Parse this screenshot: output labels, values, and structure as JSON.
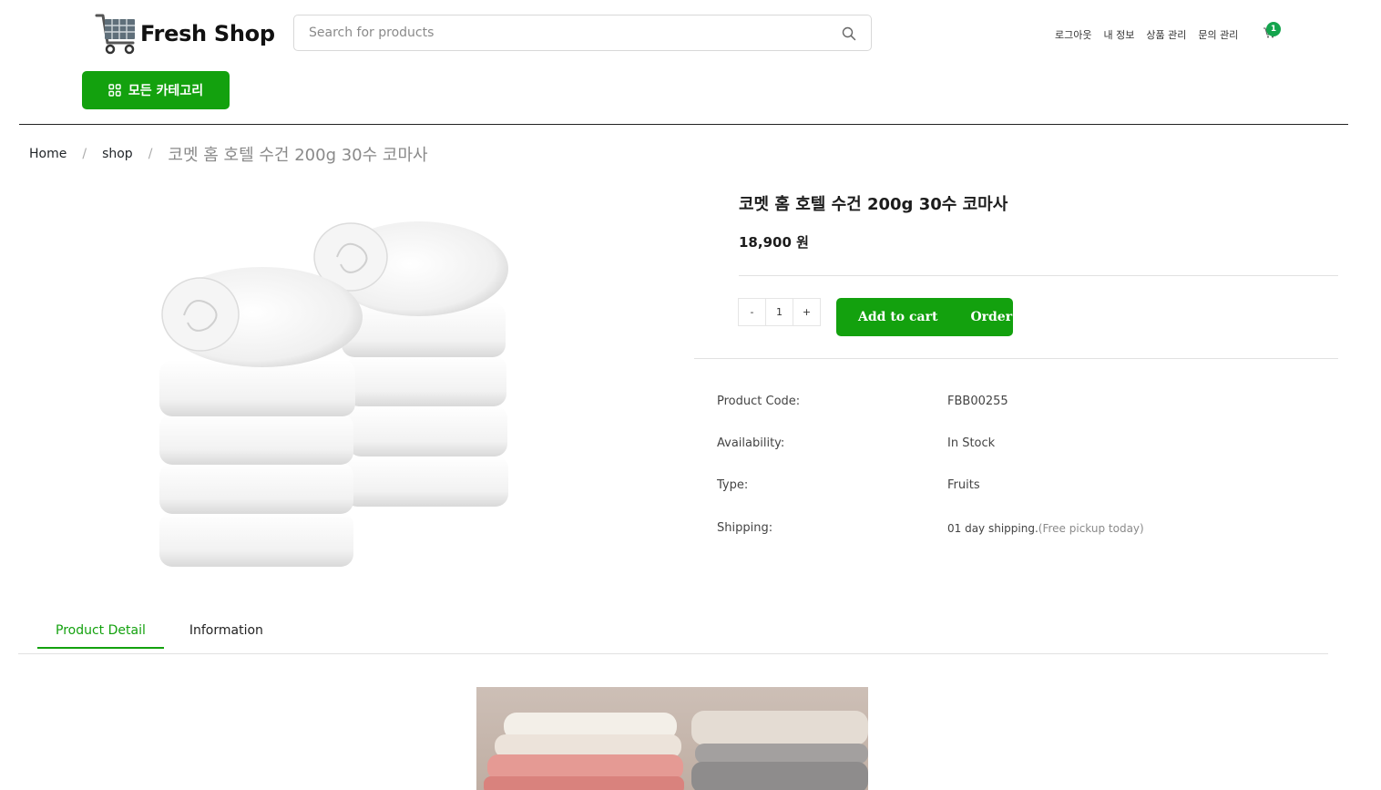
{
  "header": {
    "logo_text": "Fresh Shop",
    "search_placeholder": "Search for products",
    "nav": [
      "로그아웃",
      "내 정보",
      "상품 관리",
      "문의 관리"
    ],
    "cart_count": "1",
    "category_button": "모든 카테고리"
  },
  "breadcrumb": {
    "home": "Home",
    "shop": "shop",
    "current": "코멧 홈 호텔 수건 200g 30수 코마사"
  },
  "product": {
    "title": "코멧 홈 호텔 수건 200g 30수 코마사",
    "price": "18,900 원",
    "quantity": "1",
    "minus_label": "-",
    "plus_label": "+",
    "add_to_cart": "Add to cart",
    "order": "Order",
    "specs": [
      {
        "label": "Product Code:",
        "value": "FBB00255",
        "note": ""
      },
      {
        "label": "Availability:",
        "value": "In Stock",
        "note": ""
      },
      {
        "label": "Type:",
        "value": "Fruits",
        "note": ""
      },
      {
        "label": "Shipping:",
        "value": "01 day shipping.",
        "note": "(Free pickup today)"
      }
    ]
  },
  "tabs": {
    "detail": "Product Detail",
    "info": "Information"
  },
  "colors": {
    "accent": "#13a10e",
    "badge": "#14a44d"
  },
  "icons": [
    "cart-logo-icon",
    "search-icon",
    "cart-icon",
    "grid-icon"
  ]
}
